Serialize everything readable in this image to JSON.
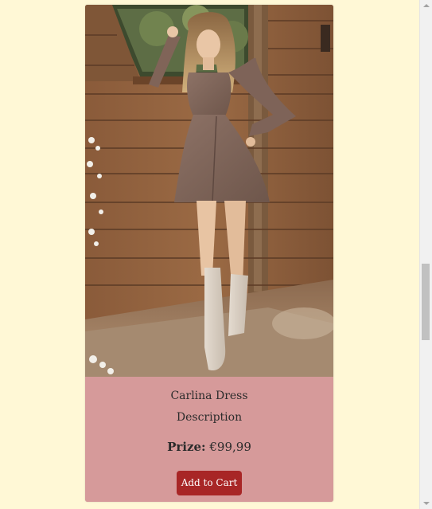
{
  "product": {
    "name": "Carlina Dress",
    "description": "Description",
    "price_label": "Prize:",
    "price_value": "€99,99",
    "add_to_cart_label": "Add to Cart",
    "image_alt": "Model wearing a brown long-sleeve mini dress with white western boots, leaning on a wooden stable door"
  },
  "colors": {
    "page_background": "#fff8d6",
    "info_panel": "#d69a9a",
    "button": "#a82626",
    "button_text": "#ffffff",
    "text": "#2c2c2c"
  },
  "scrollbar": {
    "up_icon": "chevron-up",
    "down_icon": "chevron-down"
  }
}
